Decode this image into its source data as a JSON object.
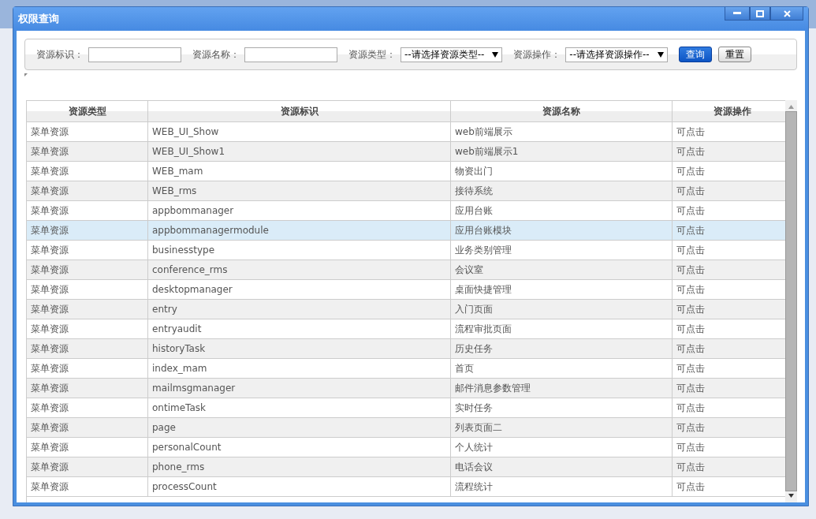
{
  "window": {
    "title": "权限查询"
  },
  "filters": [
    {
      "kind": "text",
      "label": "资源标识："
    },
    {
      "kind": "text",
      "label": "资源名称："
    },
    {
      "kind": "select",
      "label": "资源类型：",
      "value": "--请选择资源类型--"
    },
    {
      "kind": "select",
      "label": "资源操作：",
      "value": "--请选择资源操作--"
    }
  ],
  "buttons": [
    {
      "label": "查询",
      "primary": true
    },
    {
      "label": "重置",
      "primary": false
    }
  ],
  "table": {
    "columns": [
      "资源类型",
      "资源标识",
      "资源名称",
      "资源操作"
    ],
    "rows": [
      {
        "cells": [
          "菜单资源",
          "WEB_UI_Show",
          "web前端展示",
          "可点击"
        ],
        "selected": false
      },
      {
        "cells": [
          "菜单资源",
          "WEB_UI_Show1",
          "web前端展示1",
          "可点击"
        ],
        "selected": false
      },
      {
        "cells": [
          "菜单资源",
          "WEB_mam",
          "物资出门",
          "可点击"
        ],
        "selected": false
      },
      {
        "cells": [
          "菜单资源",
          "WEB_rms",
          "接待系统",
          "可点击"
        ],
        "selected": false
      },
      {
        "cells": [
          "菜单资源",
          "appbommanager",
          "应用台账",
          "可点击"
        ],
        "selected": false
      },
      {
        "cells": [
          "菜单资源",
          "appbommanagermodule",
          "应用台账模块",
          "可点击"
        ],
        "selected": true
      },
      {
        "cells": [
          "菜单资源",
          "businesstype",
          "业务类别管理",
          "可点击"
        ],
        "selected": false
      },
      {
        "cells": [
          "菜单资源",
          "conference_rms",
          "会议室",
          "可点击"
        ],
        "selected": false
      },
      {
        "cells": [
          "菜单资源",
          "desktopmanager",
          "桌面快捷管理",
          "可点击"
        ],
        "selected": false
      },
      {
        "cells": [
          "菜单资源",
          "entry",
          "入门页面",
          "可点击"
        ],
        "selected": false
      },
      {
        "cells": [
          "菜单资源",
          "entryaudit",
          "流程审批页面",
          "可点击"
        ],
        "selected": false
      },
      {
        "cells": [
          "菜单资源",
          "historyTask",
          "历史任务",
          "可点击"
        ],
        "selected": false
      },
      {
        "cells": [
          "菜单资源",
          "index_mam",
          "首页",
          "可点击"
        ],
        "selected": false
      },
      {
        "cells": [
          "菜单资源",
          "mailmsgmanager",
          "邮件消息参数管理",
          "可点击"
        ],
        "selected": false
      },
      {
        "cells": [
          "菜单资源",
          "ontimeTask",
          "实时任务",
          "可点击"
        ],
        "selected": false
      },
      {
        "cells": [
          "菜单资源",
          "page",
          "列表页面二",
          "可点击"
        ],
        "selected": false
      },
      {
        "cells": [
          "菜单资源",
          "personalCount",
          "个人统计",
          "可点击"
        ],
        "selected": false
      },
      {
        "cells": [
          "菜单资源",
          "phone_rms",
          "电话会议",
          "可点击"
        ],
        "selected": false
      },
      {
        "cells": [
          "菜单资源",
          "processCount",
          "流程统计",
          "可点击"
        ],
        "selected": false
      }
    ]
  }
}
